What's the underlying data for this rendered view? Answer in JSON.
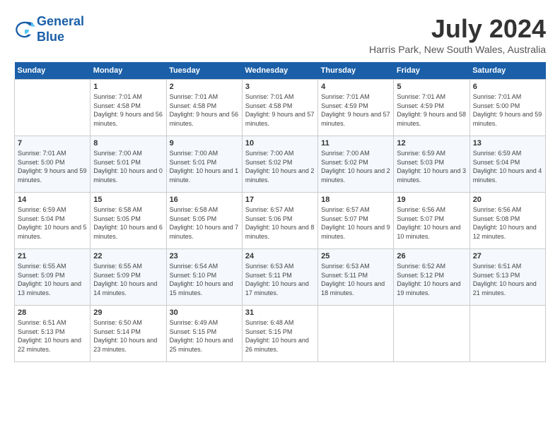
{
  "header": {
    "logo_line1": "General",
    "logo_line2": "Blue",
    "month_title": "July 2024",
    "location": "Harris Park, New South Wales, Australia"
  },
  "days_of_week": [
    "Sunday",
    "Monday",
    "Tuesday",
    "Wednesday",
    "Thursday",
    "Friday",
    "Saturday"
  ],
  "weeks": [
    [
      {
        "day": "",
        "sunrise": "",
        "sunset": "",
        "daylight": ""
      },
      {
        "day": "1",
        "sunrise": "Sunrise: 7:01 AM",
        "sunset": "Sunset: 4:58 PM",
        "daylight": "Daylight: 9 hours and 56 minutes."
      },
      {
        "day": "2",
        "sunrise": "Sunrise: 7:01 AM",
        "sunset": "Sunset: 4:58 PM",
        "daylight": "Daylight: 9 hours and 56 minutes."
      },
      {
        "day": "3",
        "sunrise": "Sunrise: 7:01 AM",
        "sunset": "Sunset: 4:58 PM",
        "daylight": "Daylight: 9 hours and 57 minutes."
      },
      {
        "day": "4",
        "sunrise": "Sunrise: 7:01 AM",
        "sunset": "Sunset: 4:59 PM",
        "daylight": "Daylight: 9 hours and 57 minutes."
      },
      {
        "day": "5",
        "sunrise": "Sunrise: 7:01 AM",
        "sunset": "Sunset: 4:59 PM",
        "daylight": "Daylight: 9 hours and 58 minutes."
      },
      {
        "day": "6",
        "sunrise": "Sunrise: 7:01 AM",
        "sunset": "Sunset: 5:00 PM",
        "daylight": "Daylight: 9 hours and 59 minutes."
      }
    ],
    [
      {
        "day": "7",
        "sunrise": "Sunrise: 7:01 AM",
        "sunset": "Sunset: 5:00 PM",
        "daylight": "Daylight: 9 hours and 59 minutes."
      },
      {
        "day": "8",
        "sunrise": "Sunrise: 7:00 AM",
        "sunset": "Sunset: 5:01 PM",
        "daylight": "Daylight: 10 hours and 0 minutes."
      },
      {
        "day": "9",
        "sunrise": "Sunrise: 7:00 AM",
        "sunset": "Sunset: 5:01 PM",
        "daylight": "Daylight: 10 hours and 1 minute."
      },
      {
        "day": "10",
        "sunrise": "Sunrise: 7:00 AM",
        "sunset": "Sunset: 5:02 PM",
        "daylight": "Daylight: 10 hours and 2 minutes."
      },
      {
        "day": "11",
        "sunrise": "Sunrise: 7:00 AM",
        "sunset": "Sunset: 5:02 PM",
        "daylight": "Daylight: 10 hours and 2 minutes."
      },
      {
        "day": "12",
        "sunrise": "Sunrise: 6:59 AM",
        "sunset": "Sunset: 5:03 PM",
        "daylight": "Daylight: 10 hours and 3 minutes."
      },
      {
        "day": "13",
        "sunrise": "Sunrise: 6:59 AM",
        "sunset": "Sunset: 5:04 PM",
        "daylight": "Daylight: 10 hours and 4 minutes."
      }
    ],
    [
      {
        "day": "14",
        "sunrise": "Sunrise: 6:59 AM",
        "sunset": "Sunset: 5:04 PM",
        "daylight": "Daylight: 10 hours and 5 minutes."
      },
      {
        "day": "15",
        "sunrise": "Sunrise: 6:58 AM",
        "sunset": "Sunset: 5:05 PM",
        "daylight": "Daylight: 10 hours and 6 minutes."
      },
      {
        "day": "16",
        "sunrise": "Sunrise: 6:58 AM",
        "sunset": "Sunset: 5:05 PM",
        "daylight": "Daylight: 10 hours and 7 minutes."
      },
      {
        "day": "17",
        "sunrise": "Sunrise: 6:57 AM",
        "sunset": "Sunset: 5:06 PM",
        "daylight": "Daylight: 10 hours and 8 minutes."
      },
      {
        "day": "18",
        "sunrise": "Sunrise: 6:57 AM",
        "sunset": "Sunset: 5:07 PM",
        "daylight": "Daylight: 10 hours and 9 minutes."
      },
      {
        "day": "19",
        "sunrise": "Sunrise: 6:56 AM",
        "sunset": "Sunset: 5:07 PM",
        "daylight": "Daylight: 10 hours and 10 minutes."
      },
      {
        "day": "20",
        "sunrise": "Sunrise: 6:56 AM",
        "sunset": "Sunset: 5:08 PM",
        "daylight": "Daylight: 10 hours and 12 minutes."
      }
    ],
    [
      {
        "day": "21",
        "sunrise": "Sunrise: 6:55 AM",
        "sunset": "Sunset: 5:09 PM",
        "daylight": "Daylight: 10 hours and 13 minutes."
      },
      {
        "day": "22",
        "sunrise": "Sunrise: 6:55 AM",
        "sunset": "Sunset: 5:09 PM",
        "daylight": "Daylight: 10 hours and 14 minutes."
      },
      {
        "day": "23",
        "sunrise": "Sunrise: 6:54 AM",
        "sunset": "Sunset: 5:10 PM",
        "daylight": "Daylight: 10 hours and 15 minutes."
      },
      {
        "day": "24",
        "sunrise": "Sunrise: 6:53 AM",
        "sunset": "Sunset: 5:11 PM",
        "daylight": "Daylight: 10 hours and 17 minutes."
      },
      {
        "day": "25",
        "sunrise": "Sunrise: 6:53 AM",
        "sunset": "Sunset: 5:11 PM",
        "daylight": "Daylight: 10 hours and 18 minutes."
      },
      {
        "day": "26",
        "sunrise": "Sunrise: 6:52 AM",
        "sunset": "Sunset: 5:12 PM",
        "daylight": "Daylight: 10 hours and 19 minutes."
      },
      {
        "day": "27",
        "sunrise": "Sunrise: 6:51 AM",
        "sunset": "Sunset: 5:13 PM",
        "daylight": "Daylight: 10 hours and 21 minutes."
      }
    ],
    [
      {
        "day": "28",
        "sunrise": "Sunrise: 6:51 AM",
        "sunset": "Sunset: 5:13 PM",
        "daylight": "Daylight: 10 hours and 22 minutes."
      },
      {
        "day": "29",
        "sunrise": "Sunrise: 6:50 AM",
        "sunset": "Sunset: 5:14 PM",
        "daylight": "Daylight: 10 hours and 23 minutes."
      },
      {
        "day": "30",
        "sunrise": "Sunrise: 6:49 AM",
        "sunset": "Sunset: 5:15 PM",
        "daylight": "Daylight: 10 hours and 25 minutes."
      },
      {
        "day": "31",
        "sunrise": "Sunrise: 6:48 AM",
        "sunset": "Sunset: 5:15 PM",
        "daylight": "Daylight: 10 hours and 26 minutes."
      },
      {
        "day": "",
        "sunrise": "",
        "sunset": "",
        "daylight": ""
      },
      {
        "day": "",
        "sunrise": "",
        "sunset": "",
        "daylight": ""
      },
      {
        "day": "",
        "sunrise": "",
        "sunset": "",
        "daylight": ""
      }
    ]
  ]
}
